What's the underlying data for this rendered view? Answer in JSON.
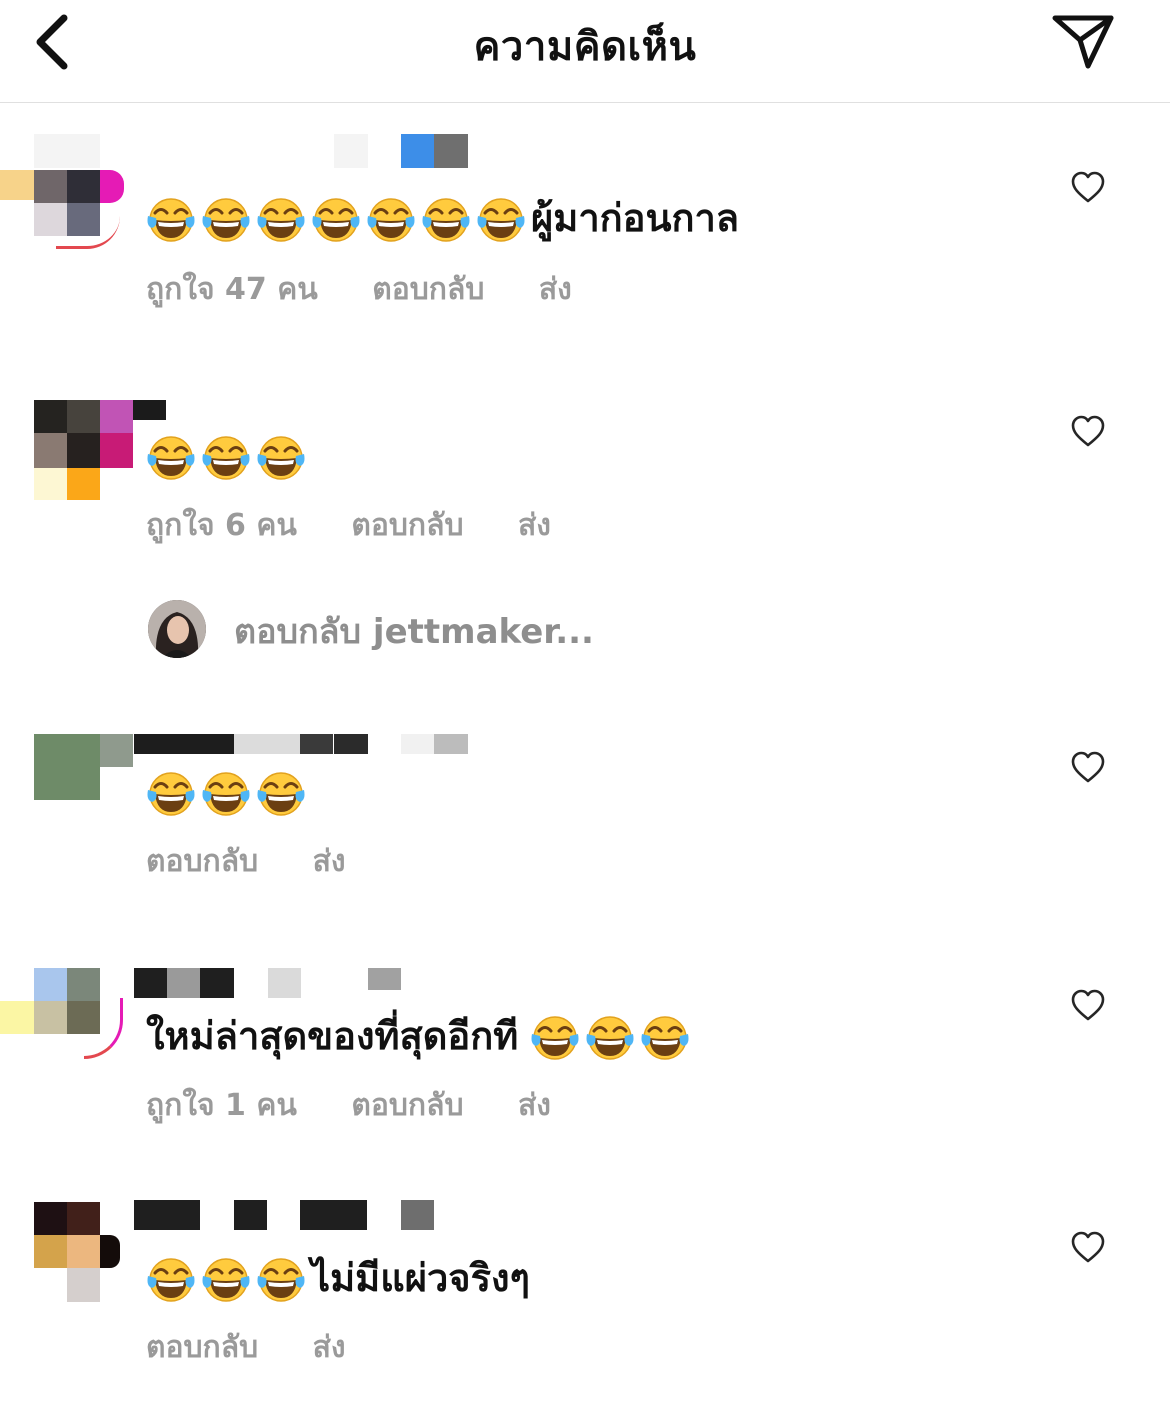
{
  "header": {
    "title": "ความคิดเห็น",
    "back_icon": "chevron-left-icon",
    "share_icon": "paper-plane-icon"
  },
  "comments": [
    {
      "text": "ผู้มาก่อนกาล",
      "emoji_count": 7,
      "likes": "ถูกใจ 47 คน",
      "reply": "ตอบกลับ",
      "send": "ส่ง"
    },
    {
      "text": "",
      "emoji_count": 3,
      "likes": "ถูกใจ 6 คน",
      "reply": "ตอบกลับ",
      "send": "ส่ง",
      "view_replies": "ตอบกลับ jettmaker..."
    },
    {
      "text": "",
      "emoji_count": 3,
      "reply": "ตอบกลับ",
      "send": "ส่ง"
    },
    {
      "text": "ใหม่ล่าสุดของที่สุดอีกที",
      "emoji_count": 3,
      "likes": "ถูกใจ 1 คน",
      "reply": "ตอบกลับ",
      "send": "ส่ง"
    },
    {
      "text": "ไม่มีแผ่วจริงๆ",
      "emoji_count": 3,
      "reply": "ตอบกลับ",
      "send": "ส่ง"
    }
  ],
  "icons": {
    "heart": "heart-outline-icon",
    "emoji": "face-with-tears-of-joy-icon"
  }
}
